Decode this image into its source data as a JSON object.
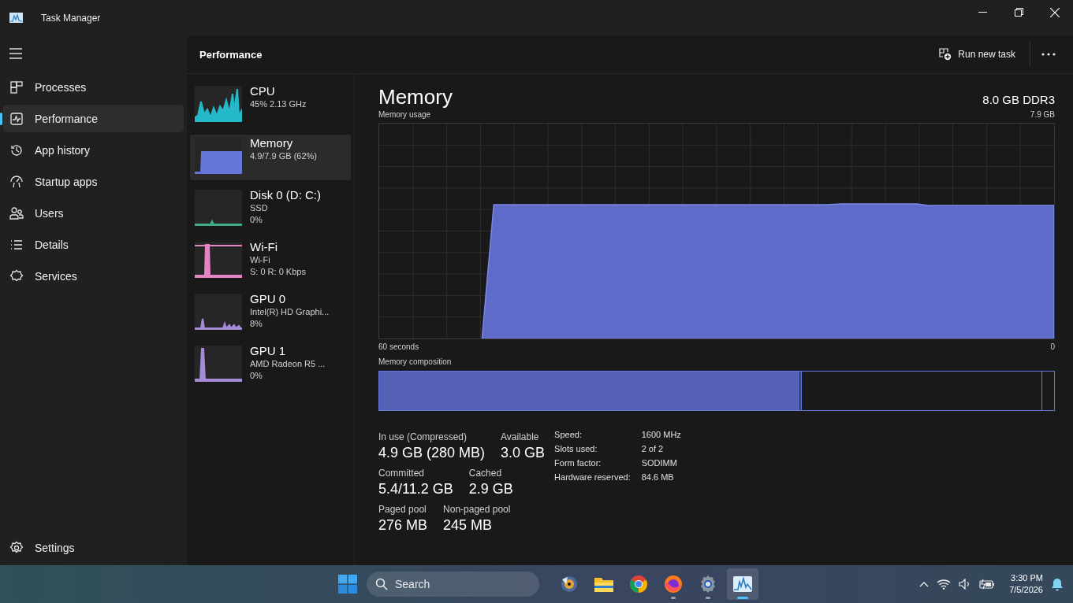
{
  "window": {
    "title": "Task Manager"
  },
  "nav": {
    "items": [
      {
        "label": "Processes",
        "kind": "processes",
        "selected": false
      },
      {
        "label": "Performance",
        "kind": "performance",
        "selected": true
      },
      {
        "label": "App history",
        "kind": "history",
        "selected": false
      },
      {
        "label": "Startup apps",
        "kind": "startup",
        "selected": false
      },
      {
        "label": "Users",
        "kind": "users",
        "selected": false
      },
      {
        "label": "Details",
        "kind": "details",
        "selected": false
      },
      {
        "label": "Services",
        "kind": "services",
        "selected": false
      }
    ],
    "footer": {
      "label": "Settings",
      "kind": "settings",
      "selected": false
    }
  },
  "header": {
    "title": "Performance",
    "run_task": "Run new task"
  },
  "devices": [
    {
      "name": "CPU",
      "kind": "cpu",
      "lines": [
        "45%  2.13 GHz"
      ],
      "color": "#25b8c8",
      "selected": false
    },
    {
      "name": "Memory",
      "kind": "memory",
      "lines": [
        "4.9/7.9 GB (62%)"
      ],
      "color": "#6675d8",
      "selected": true
    },
    {
      "name": "Disk 0 (D: C:)",
      "kind": "disk",
      "lines": [
        "SSD",
        "0%"
      ],
      "color": "#3fae86",
      "selected": false
    },
    {
      "name": "Wi-Fi",
      "kind": "network",
      "lines": [
        "Wi-Fi",
        "S: 0 R: 0 Kbps"
      ],
      "color": "#e584c4",
      "selected": false
    },
    {
      "name": "GPU 0",
      "kind": "gpu",
      "lines": [
        "Intel(R) HD Graphi...",
        "8%"
      ],
      "color": "#a58ad8",
      "selected": false
    },
    {
      "name": "GPU 1",
      "kind": "gpu_spike",
      "lines": [
        "AMD Radeon R5 ...",
        "0%"
      ],
      "color": "#a58ad8",
      "selected": false
    }
  ],
  "detail": {
    "title": "Memory",
    "subtitle": "8.0 GB DDR3",
    "usage_label": "Memory usage",
    "usage_max": "7.9 GB",
    "time_label": "60 seconds",
    "usage_min": "0",
    "composition_label": "Memory composition",
    "stat_rows": [
      [
        {
          "label": "In use (Compressed)",
          "value": "4.9 GB (280 MB)"
        },
        {
          "label": "Available",
          "value": "3.0 GB"
        }
      ],
      [
        {
          "label": "Committed",
          "value": "5.4/11.2 GB"
        },
        {
          "label": "Cached",
          "value": "2.9 GB"
        }
      ],
      [
        {
          "label": "Paged pool",
          "value": "276 MB"
        },
        {
          "label": "Non-paged pool",
          "value": "245 MB"
        }
      ]
    ],
    "specs": [
      {
        "label": "Speed:",
        "value": "1600 MHz"
      },
      {
        "label": "Slots used:",
        "value": "2 of 2"
      },
      {
        "label": "Form factor:",
        "value": "SODIMM"
      },
      {
        "label": "Hardware reserved:",
        "value": "84.6 MB"
      }
    ]
  },
  "taskbar": {
    "search": {
      "placeholder": "Search"
    },
    "apps": [
      {
        "kind": "media",
        "running": false,
        "selected": false
      },
      {
        "kind": "folder",
        "running": false,
        "selected": false
      },
      {
        "kind": "chrome",
        "running": false,
        "selected": false
      },
      {
        "kind": "firefox",
        "running": true,
        "selected": false
      },
      {
        "kind": "settings",
        "running": true,
        "selected": false
      },
      {
        "kind": "taskmanager",
        "running": true,
        "selected": true
      }
    ],
    "time": "3:30 PM",
    "date": "7/5/2026"
  }
}
